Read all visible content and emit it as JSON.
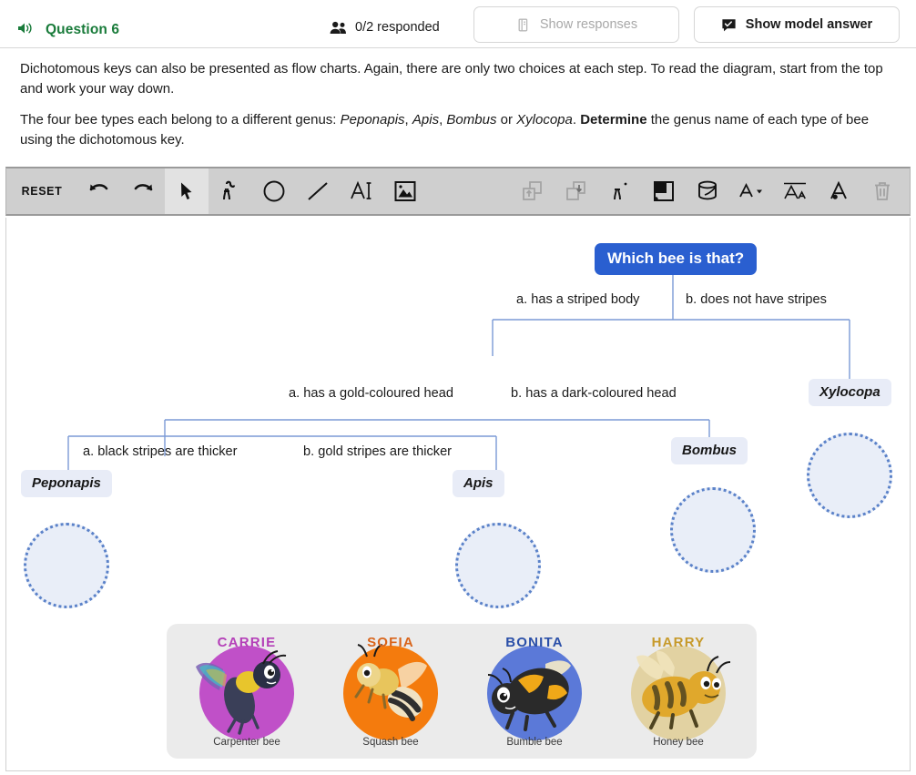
{
  "header": {
    "speaker_icon": "speaker-icon",
    "question_title": "Question 6",
    "people_icon": "people-icon",
    "responded": "0/2 responded",
    "show_responses_label": "Show responses",
    "show_responses_icon": "responses-panel-icon",
    "show_answer_label": "Show model answer",
    "show_answer_icon": "speech-bubble-check-icon",
    "title_color": "#197b3a"
  },
  "prose": {
    "p1": "Dichotomous keys can also be presented as flow charts. Again, there are only two choices at each step. To read the diagram, start from the top and work your way down.",
    "p2_a": "The four bee types each belong to a different genus: ",
    "p2_g1": "Peponapis",
    "p2_sep1": ", ",
    "p2_g2": "Apis",
    "p2_sep2": ", ",
    "p2_g3": "Bombus",
    "p2_sep3": " or ",
    "p2_g4": "Xylocopa",
    "p2_sep4": ". ",
    "p2_bold": "Determine",
    "p2_end": " the genus name of each type of bee using the dichotomous key."
  },
  "toolbar": {
    "reset_label": "RESET",
    "left_tools": [
      {
        "name": "undo-icon",
        "icon": "undo"
      },
      {
        "name": "redo-icon",
        "icon": "redo"
      },
      {
        "name": "select-cursor-icon",
        "icon": "cursor",
        "active": true
      },
      {
        "name": "pen-draw-icon",
        "icon": "pen"
      },
      {
        "name": "ellipse-icon",
        "icon": "circle"
      },
      {
        "name": "line-icon",
        "icon": "line"
      },
      {
        "name": "text-icon",
        "icon": "text"
      },
      {
        "name": "image-icon",
        "icon": "image"
      }
    ],
    "right_tools": [
      {
        "name": "bring-forward-icon",
        "icon": "bring-forward",
        "dim": true
      },
      {
        "name": "send-backward-icon",
        "icon": "send-backward",
        "dim": true
      },
      {
        "name": "eyedropper-icon",
        "icon": "eyedropper"
      },
      {
        "name": "fill-shape-icon",
        "icon": "fill-shape"
      },
      {
        "name": "paint-bucket-icon",
        "icon": "paint-bucket"
      },
      {
        "name": "font-colour-icon",
        "icon": "font-colour"
      },
      {
        "name": "font-size-icon",
        "icon": "font-size"
      },
      {
        "name": "text-fill-icon",
        "icon": "text-fill"
      },
      {
        "name": "delete-trash-icon",
        "icon": "trash",
        "dim": true
      }
    ]
  },
  "flowchart": {
    "root": "Which bee is that?",
    "root_color": "#2a5fd0",
    "branches": [
      {
        "key": "b1a",
        "label": "a. has a striped body"
      },
      {
        "key": "b1b",
        "label": "b. does not have stripes"
      },
      {
        "key": "b2a",
        "label": "a. has a gold-coloured head"
      },
      {
        "key": "b2b",
        "label": "b. has a dark-coloured head"
      },
      {
        "key": "b3a",
        "label": "a. black stripes are thicker"
      },
      {
        "key": "b3b",
        "label": "b. gold stripes are thicker"
      }
    ],
    "genus": [
      {
        "key": "peponapis",
        "label": "Peponapis"
      },
      {
        "key": "apis",
        "label": "Apis"
      },
      {
        "key": "bombus",
        "label": "Bombus"
      },
      {
        "key": "xylocopa",
        "label": "Xylocopa"
      }
    ],
    "drop_zones": [
      {
        "key": "drop-peponapis"
      },
      {
        "key": "drop-apis"
      },
      {
        "key": "drop-bombus"
      },
      {
        "key": "drop-xylocopa"
      }
    ]
  },
  "bee_tray": {
    "bees": [
      {
        "key": "carrie",
        "name": "CARRIE",
        "sub": "Carpenter bee",
        "name_color": "#b43fb8",
        "disc_color": "#c050c8"
      },
      {
        "key": "sofia",
        "name": "SOFIA",
        "sub": "Squash bee",
        "name_color": "#d9641a",
        "disc_color": "#f47b0d"
      },
      {
        "key": "bonita",
        "name": "BONITA",
        "sub": "Bumble bee",
        "name_color": "#2a4fa8",
        "disc_color": "#5b79d8"
      },
      {
        "key": "harry",
        "name": "HARRY",
        "sub": "Honey bee",
        "name_color": "#c79a2a",
        "disc_color": "#e2d2a2"
      }
    ]
  }
}
